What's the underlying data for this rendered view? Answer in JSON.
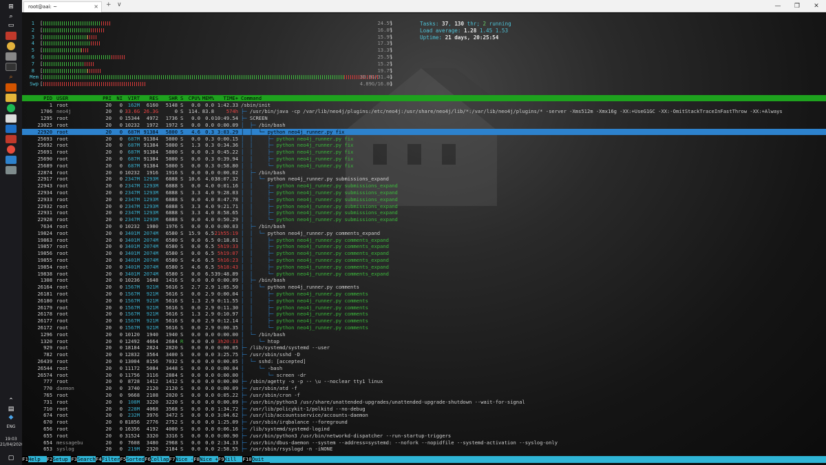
{
  "window": {
    "tab_title": "root@aai: ~",
    "new_tab": "+",
    "dropdown": "∨",
    "minimize": "—",
    "maximize": "❐",
    "close": "✕",
    "tab_close": "×"
  },
  "taskbar": {
    "lang": "ENG",
    "time": "19:03",
    "date": "21/04/2020"
  },
  "meters": {
    "cpus": [
      {
        "id": "1",
        "pct": "24.5%",
        "green": 0.17,
        "red": 0.03
      },
      {
        "id": "2",
        "pct": "16.0%",
        "green": 0.14,
        "red": 0.04
      },
      {
        "id": "3",
        "pct": "15.9%",
        "green": 0.13,
        "red": 0.03
      },
      {
        "id": "4",
        "pct": "17.3%",
        "green": 0.14,
        "red": 0.03
      },
      {
        "id": "5",
        "pct": "13.3%",
        "green": 0.11,
        "red": 0.02
      },
      {
        "id": "6",
        "pct": "25.5%",
        "green": 0.2,
        "red": 0.04
      },
      {
        "id": "7",
        "pct": "15.2%",
        "green": 0.12,
        "red": 0.03
      },
      {
        "id": "8",
        "pct": "19.7%",
        "green": 0.13,
        "red": 0.04
      }
    ],
    "mem": {
      "label": "Mem",
      "text": "30.8G/31.4G",
      "fill": 0.98
    },
    "swp": {
      "label": "Swp",
      "text": "4.89G/16.0G",
      "fill": 0.3
    }
  },
  "info": {
    "tasks_label": "Tasks: ",
    "tasks": "37",
    "thr_sep": ", ",
    "thr": "130",
    "thr_label": " thr; ",
    "running": "2",
    "running_label": " running",
    "load_label": "Load average: ",
    "load1": "1.28",
    "load5": "1.45",
    "load15": "1.53",
    "uptime_label": "Uptime: ",
    "uptime": "21 days, 20:25:54"
  },
  "columns": [
    "PID",
    "USER",
    "PRI",
    "NI",
    "VIRT",
    "RES",
    "SHR",
    "S",
    "CPU%",
    "MEM%",
    "TIME+",
    "Command"
  ],
  "processes": [
    {
      "pid": "1",
      "user": "root",
      "pri": "20",
      "ni": "0",
      "virt": "162M",
      "res": "6160",
      "shr": "5148",
      "s": "S",
      "cpu": "0.0",
      "mem": "0.0",
      "time": "1:42.33",
      "tree": "",
      "cmd": "/sbin/init"
    },
    {
      "pid": "1706",
      "user": "neo4j",
      "pri": "20",
      "ni": "0",
      "virt": "33.6G",
      "res": "26.3G",
      "shr": "0",
      "s": "S",
      "cpu": "114.",
      "mem": "83.8",
      "time": "574h",
      "tree": "├─ ",
      "cmd": "/usr/bin/java -cp /var/lib/neo4j/plugins:/etc/neo4j:/usr/share/neo4j/lib/*:/var/lib/neo4j/plugins/* -server -Xms512m -Xmx16g -XX:+UseG1GC -XX:-OmitStackTraceInFastThrow -XX:+Always"
    },
    {
      "pid": "1295",
      "user": "root",
      "pri": "20",
      "ni": "0",
      "virt": "15344",
      "res": "4972",
      "shr": "1736",
      "s": "S",
      "cpu": "0.0",
      "mem": "0.0",
      "time": "10:49.54",
      "tree": "├─ ",
      "cmd": "SCREEN"
    },
    {
      "pid": "23025",
      "user": "root",
      "pri": "20",
      "ni": "0",
      "virt": "10232",
      "res": "1972",
      "shr": "1972",
      "s": "S",
      "cpu": "0.0",
      "mem": "0.0",
      "time": "0:00.09",
      "tree": "│  ├─ ",
      "cmd": "/bin/bash"
    },
    {
      "pid": "22920",
      "user": "root",
      "pri": "20",
      "ni": "0",
      "virt": "687M",
      "res": "91384",
      "shr": "5800",
      "s": "S",
      "cpu": "4.6",
      "mem": "0.3",
      "time": "3:03.29",
      "tree": "│  │  └─ ",
      "cmd": "python neo4j_runner.py fix",
      "sel": true
    },
    {
      "pid": "25693",
      "user": "root",
      "pri": "20",
      "ni": "0",
      "virt": "687M",
      "res": "91384",
      "shr": "5800",
      "s": "S",
      "cpu": "0.0",
      "mem": "0.3",
      "time": "0:00.15",
      "tree": "│  │     ├─ ",
      "cmd": "python neo4j_runner.py fix",
      "thread": true
    },
    {
      "pid": "25692",
      "user": "root",
      "pri": "20",
      "ni": "0",
      "virt": "687M",
      "res": "91384",
      "shr": "5800",
      "s": "S",
      "cpu": "1.3",
      "mem": "0.3",
      "time": "0:34.36",
      "tree": "│  │     ├─ ",
      "cmd": "python neo4j_runner.py fix",
      "thread": true
    },
    {
      "pid": "25691",
      "user": "root",
      "pri": "20",
      "ni": "0",
      "virt": "687M",
      "res": "91384",
      "shr": "5800",
      "s": "S",
      "cpu": "0.0",
      "mem": "0.3",
      "time": "0:45.22",
      "tree": "│  │     ├─ ",
      "cmd": "python neo4j_runner.py fix",
      "thread": true
    },
    {
      "pid": "25690",
      "user": "root",
      "pri": "20",
      "ni": "0",
      "virt": "687M",
      "res": "91384",
      "shr": "5800",
      "s": "S",
      "cpu": "0.0",
      "mem": "0.3",
      "time": "0:39.94",
      "tree": "│  │     ├─ ",
      "cmd": "python neo4j_runner.py fix",
      "thread": true
    },
    {
      "pid": "25689",
      "user": "root",
      "pri": "20",
      "ni": "0",
      "virt": "687M",
      "res": "91384",
      "shr": "5800",
      "s": "S",
      "cpu": "0.0",
      "mem": "0.3",
      "time": "0:58.80",
      "tree": "│  │     └─ ",
      "cmd": "python neo4j_runner.py fix",
      "thread": true
    },
    {
      "pid": "22874",
      "user": "root",
      "pri": "20",
      "ni": "0",
      "virt": "10232",
      "res": "1916",
      "shr": "1916",
      "s": "S",
      "cpu": "0.0",
      "mem": "0.0",
      "time": "0:00.02",
      "tree": "│  ├─ ",
      "cmd": "/bin/bash"
    },
    {
      "pid": "22917",
      "user": "root",
      "pri": "20",
      "ni": "0",
      "virt": "2347M",
      "res": "1293M",
      "shr": "6888",
      "s": "S",
      "cpu": "10.6",
      "mem": "4.0",
      "time": "38:07.32",
      "tree": "│  │  └─ ",
      "cmd": "python neo4j_runner.py submissions_expand"
    },
    {
      "pid": "22943",
      "user": "root",
      "pri": "20",
      "ni": "0",
      "virt": "2347M",
      "res": "1293M",
      "shr": "6888",
      "s": "S",
      "cpu": "0.0",
      "mem": "4.0",
      "time": "0:01.16",
      "tree": "│  │     ├─ ",
      "cmd": "python neo4j_runner.py submissions_expand",
      "thread": true
    },
    {
      "pid": "22934",
      "user": "root",
      "pri": "20",
      "ni": "0",
      "virt": "2347M",
      "res": "1293M",
      "shr": "6888",
      "s": "S",
      "cpu": "3.3",
      "mem": "4.0",
      "time": "9:28.03",
      "tree": "│  │     ├─ ",
      "cmd": "python neo4j_runner.py submissions_expand",
      "thread": true
    },
    {
      "pid": "22933",
      "user": "root",
      "pri": "20",
      "ni": "0",
      "virt": "2347M",
      "res": "1293M",
      "shr": "6888",
      "s": "S",
      "cpu": "0.0",
      "mem": "4.0",
      "time": "8:47.78",
      "tree": "│  │     ├─ ",
      "cmd": "python neo4j_runner.py submissions_expand",
      "thread": true
    },
    {
      "pid": "22932",
      "user": "root",
      "pri": "20",
      "ni": "0",
      "virt": "2347M",
      "res": "1293M",
      "shr": "6888",
      "s": "S",
      "cpu": "3.3",
      "mem": "4.0",
      "time": "9:21.71",
      "tree": "│  │     ├─ ",
      "cmd": "python neo4j_runner.py submissions_expand",
      "thread": true
    },
    {
      "pid": "22931",
      "user": "root",
      "pri": "20",
      "ni": "0",
      "virt": "2347M",
      "res": "1293M",
      "shr": "6888",
      "s": "S",
      "cpu": "3.3",
      "mem": "4.0",
      "time": "8:58.65",
      "tree": "│  │     ├─ ",
      "cmd": "python neo4j_runner.py submissions_expand",
      "thread": true
    },
    {
      "pid": "22928",
      "user": "root",
      "pri": "20",
      "ni": "0",
      "virt": "2347M",
      "res": "1293M",
      "shr": "6888",
      "s": "S",
      "cpu": "0.0",
      "mem": "4.0",
      "time": "0:50.29",
      "tree": "│  │     └─ ",
      "cmd": "python neo4j_runner.py submissions_expand",
      "thread": true
    },
    {
      "pid": "7634",
      "user": "root",
      "pri": "20",
      "ni": "0",
      "virt": "10232",
      "res": "1980",
      "shr": "1976",
      "s": "S",
      "cpu": "0.0",
      "mem": "0.0",
      "time": "0:00.03",
      "tree": "│  ├─ ",
      "cmd": "/bin/bash"
    },
    {
      "pid": "19824",
      "user": "root",
      "pri": "20",
      "ni": "0",
      "virt": "3401M",
      "res": "2074M",
      "shr": "6580",
      "s": "S",
      "cpu": "15.9",
      "mem": "6.5",
      "time": "21h55:19",
      "tree": "│  │  └─ ",
      "cmd": "python neo4j_runner.py comments_expand"
    },
    {
      "pid": "19863",
      "user": "root",
      "pri": "20",
      "ni": "0",
      "virt": "3401M",
      "res": "2074M",
      "shr": "6580",
      "s": "S",
      "cpu": "0.0",
      "mem": "6.5",
      "time": "0:18.61",
      "tree": "│  │     ├─ ",
      "cmd": "python neo4j_runner.py comments_expand",
      "thread": true
    },
    {
      "pid": "19857",
      "user": "root",
      "pri": "20",
      "ni": "0",
      "virt": "3401M",
      "res": "2074M",
      "shr": "6580",
      "s": "S",
      "cpu": "0.0",
      "mem": "6.5",
      "time": "5h19:33",
      "tree": "│  │     ├─ ",
      "cmd": "python neo4j_runner.py comments_expand",
      "thread": true
    },
    {
      "pid": "19856",
      "user": "root",
      "pri": "20",
      "ni": "0",
      "virt": "3401M",
      "res": "2074M",
      "shr": "6580",
      "s": "S",
      "cpu": "0.0",
      "mem": "6.5",
      "time": "5h19:07",
      "tree": "│  │     ├─ ",
      "cmd": "python neo4j_runner.py comments_expand",
      "thread": true
    },
    {
      "pid": "19855",
      "user": "root",
      "pri": "20",
      "ni": "0",
      "virt": "3401M",
      "res": "2074M",
      "shr": "6580",
      "s": "S",
      "cpu": "4.6",
      "mem": "6.5",
      "time": "5h16:23",
      "tree": "│  │     ├─ ",
      "cmd": "python neo4j_runner.py comments_expand",
      "thread": true
    },
    {
      "pid": "19854",
      "user": "root",
      "pri": "20",
      "ni": "0",
      "virt": "3401M",
      "res": "2074M",
      "shr": "6580",
      "s": "S",
      "cpu": "4.6",
      "mem": "6.5",
      "time": "5h18:43",
      "tree": "│  │     ├─ ",
      "cmd": "python neo4j_runner.py comments_expand",
      "thread": true
    },
    {
      "pid": "19838",
      "user": "root",
      "pri": "20",
      "ni": "0",
      "virt": "3401M",
      "res": "2074M",
      "shr": "6580",
      "s": "S",
      "cpu": "0.0",
      "mem": "6.5",
      "time": "39:48.89",
      "tree": "│  │     └─ ",
      "cmd": "python neo4j_runner.py comments_expand",
      "thread": true
    },
    {
      "pid": "1308",
      "user": "root",
      "pri": "20",
      "ni": "0",
      "virt": "10236",
      "res": "1648",
      "shr": "1416",
      "s": "S",
      "cpu": "0.0",
      "mem": "0.0",
      "time": "0:00.09",
      "tree": "│  ├─ ",
      "cmd": "/bin/bash"
    },
    {
      "pid": "26164",
      "user": "root",
      "pri": "20",
      "ni": "0",
      "virt": "1567M",
      "res": "921M",
      "shr": "5616",
      "s": "S",
      "cpu": "2.7",
      "mem": "2.9",
      "time": "1:05.50",
      "tree": "│  │  └─ ",
      "cmd": "python neo4j_runner.py comments"
    },
    {
      "pid": "26181",
      "user": "root",
      "pri": "20",
      "ni": "0",
      "virt": "1567M",
      "res": "921M",
      "shr": "5616",
      "s": "S",
      "cpu": "0.0",
      "mem": "2.9",
      "time": "0:00.04",
      "tree": "│  │     ├─ ",
      "cmd": "python neo4j_runner.py comments",
      "thread": true
    },
    {
      "pid": "26180",
      "user": "root",
      "pri": "20",
      "ni": "0",
      "virt": "1567M",
      "res": "921M",
      "shr": "5616",
      "s": "S",
      "cpu": "1.3",
      "mem": "2.9",
      "time": "0:11.55",
      "tree": "│  │     ├─ ",
      "cmd": "python neo4j_runner.py comments",
      "thread": true
    },
    {
      "pid": "26179",
      "user": "root",
      "pri": "20",
      "ni": "0",
      "virt": "1567M",
      "res": "921M",
      "shr": "5616",
      "s": "S",
      "cpu": "0.0",
      "mem": "2.9",
      "time": "0:11.30",
      "tree": "│  │     ├─ ",
      "cmd": "python neo4j_runner.py comments",
      "thread": true
    },
    {
      "pid": "26178",
      "user": "root",
      "pri": "20",
      "ni": "0",
      "virt": "1567M",
      "res": "921M",
      "shr": "5616",
      "s": "S",
      "cpu": "1.3",
      "mem": "2.9",
      "time": "0:10.97",
      "tree": "│  │     ├─ ",
      "cmd": "python neo4j_runner.py comments",
      "thread": true
    },
    {
      "pid": "26177",
      "user": "root",
      "pri": "20",
      "ni": "0",
      "virt": "1567M",
      "res": "921M",
      "shr": "5616",
      "s": "S",
      "cpu": "0.0",
      "mem": "2.9",
      "time": "0:12.14",
      "tree": "│  │     ├─ ",
      "cmd": "python neo4j_runner.py comments",
      "thread": true
    },
    {
      "pid": "26172",
      "user": "root",
      "pri": "20",
      "ni": "0",
      "virt": "1567M",
      "res": "921M",
      "shr": "5616",
      "s": "S",
      "cpu": "0.0",
      "mem": "2.9",
      "time": "0:00.35",
      "tree": "│  │     └─ ",
      "cmd": "python neo4j_runner.py comments",
      "thread": true
    },
    {
      "pid": "1296",
      "user": "root",
      "pri": "20",
      "ni": "0",
      "virt": "10120",
      "res": "1940",
      "shr": "1940",
      "s": "S",
      "cpu": "0.0",
      "mem": "0.0",
      "time": "0:00.00",
      "tree": "│  └─ ",
      "cmd": "/bin/bash"
    },
    {
      "pid": "1320",
      "user": "root",
      "pri": "20",
      "ni": "0",
      "virt": "12492",
      "res": "4664",
      "shr": "2684",
      "s": "R",
      "cpu": "0.0",
      "mem": "0.0",
      "time": "3h20:33",
      "tree": "│     └─ ",
      "cmd": "htop"
    },
    {
      "pid": "929",
      "user": "root",
      "pri": "20",
      "ni": "0",
      "virt": "18184",
      "res": "2824",
      "shr": "2820",
      "s": "S",
      "cpu": "0.0",
      "mem": "0.0",
      "time": "0:00.05",
      "tree": "├─ ",
      "cmd": "/lib/systemd/systemd --user"
    },
    {
      "pid": "782",
      "user": "root",
      "pri": "20",
      "ni": "0",
      "virt": "12832",
      "res": "3564",
      "shr": "3400",
      "s": "S",
      "cpu": "0.0",
      "mem": "0.0",
      "time": "3:25.75",
      "tree": "├─ ",
      "cmd": "/usr/sbin/sshd -D"
    },
    {
      "pid": "26439",
      "user": "root",
      "pri": "20",
      "ni": "0",
      "virt": "13004",
      "res": "8156",
      "shr": "7032",
      "s": "S",
      "cpu": "0.0",
      "mem": "0.0",
      "time": "0:00.05",
      "tree": "│  └─ ",
      "cmd": "sshd: [accepted]"
    },
    {
      "pid": "26544",
      "user": "root",
      "pri": "20",
      "ni": "0",
      "virt": "11172",
      "res": "5084",
      "shr": "3448",
      "s": "S",
      "cpu": "0.0",
      "mem": "0.0",
      "time": "0:00.04",
      "tree": "│     └─ ",
      "cmd": "-bash"
    },
    {
      "pid": "26574",
      "user": "root",
      "pri": "20",
      "ni": "0",
      "virt": "11756",
      "res": "3116",
      "shr": "2884",
      "s": "S",
      "cpu": "0.0",
      "mem": "0.0",
      "time": "0:00.00",
      "tree": "│        └─ ",
      "cmd": "screen -dr"
    },
    {
      "pid": "777",
      "user": "root",
      "pri": "20",
      "ni": "0",
      "virt": "8728",
      "res": "1412",
      "shr": "1412",
      "s": "S",
      "cpu": "0.0",
      "mem": "0.0",
      "time": "0:00.00",
      "tree": "├─ ",
      "cmd": "/sbin/agetty -o -p -- \\u --noclear tty1 linux"
    },
    {
      "pid": "770",
      "user": "daemon",
      "pri": "20",
      "ni": "0",
      "virt": "3740",
      "res": "2120",
      "shr": "2120",
      "s": "S",
      "cpu": "0.0",
      "mem": "0.0",
      "time": "0:00.09",
      "tree": "├─ ",
      "cmd": "/usr/sbin/atd -f"
    },
    {
      "pid": "765",
      "user": "root",
      "pri": "20",
      "ni": "0",
      "virt": "9668",
      "res": "2108",
      "shr": "2020",
      "s": "S",
      "cpu": "0.0",
      "mem": "0.0",
      "time": "0:05.22",
      "tree": "├─ ",
      "cmd": "/usr/sbin/cron -f"
    },
    {
      "pid": "731",
      "user": "root",
      "pri": "20",
      "ni": "0",
      "virt": "108M",
      "res": "3220",
      "shr": "3220",
      "s": "S",
      "cpu": "0.0",
      "mem": "0.0",
      "time": "0:00.09",
      "tree": "├─ ",
      "cmd": "/usr/bin/python3 /usr/share/unattended-upgrades/unattended-upgrade-shutdown --wait-for-signal"
    },
    {
      "pid": "710",
      "user": "root",
      "pri": "20",
      "ni": "0",
      "virt": "228M",
      "res": "4068",
      "shr": "3568",
      "s": "S",
      "cpu": "0.0",
      "mem": "0.0",
      "time": "1:34.72",
      "tree": "├─ ",
      "cmd": "/usr/lib/policykit-1/polkitd --no-debug"
    },
    {
      "pid": "674",
      "user": "root",
      "pri": "20",
      "ni": "0",
      "virt": "232M",
      "res": "3976",
      "shr": "3472",
      "s": "S",
      "cpu": "0.0",
      "mem": "0.0",
      "time": "3:04.62",
      "tree": "├─ ",
      "cmd": "/usr/lib/accountsservice/accounts-daemon"
    },
    {
      "pid": "670",
      "user": "root",
      "pri": "20",
      "ni": "0",
      "virt": "81856",
      "res": "2776",
      "shr": "2752",
      "s": "S",
      "cpu": "0.0",
      "mem": "0.0",
      "time": "1:25.09",
      "tree": "├─ ",
      "cmd": "/usr/sbin/irqbalance --foreground"
    },
    {
      "pid": "656",
      "user": "root",
      "pri": "20",
      "ni": "0",
      "virt": "16356",
      "res": "4192",
      "shr": "4000",
      "s": "S",
      "cpu": "0.0",
      "mem": "0.0",
      "time": "0:06.16",
      "tree": "├─ ",
      "cmd": "/lib/systemd/systemd-logind"
    },
    {
      "pid": "655",
      "user": "root",
      "pri": "20",
      "ni": "0",
      "virt": "31524",
      "res": "3320",
      "shr": "3316",
      "s": "S",
      "cpu": "0.0",
      "mem": "0.0",
      "time": "0:00.90",
      "tree": "├─ ",
      "cmd": "/usr/bin/python3 /usr/bin/networkd-dispatcher --run-startup-triggers"
    },
    {
      "pid": "654",
      "user": "messagebu",
      "pri": "20",
      "ni": "0",
      "virt": "7608",
      "res": "3480",
      "shr": "2968",
      "s": "S",
      "cpu": "0.0",
      "mem": "0.0",
      "time": "2:34.33",
      "tree": "├─ ",
      "cmd": "/usr/bin/dbus-daemon --system --address=systemd: --nofork --nopidfile --systemd-activation --syslog-only"
    },
    {
      "pid": "653",
      "user": "syslog",
      "pri": "20",
      "ni": "0",
      "virt": "219M",
      "res": "2320",
      "shr": "2184",
      "s": "S",
      "cpu": "0.0",
      "mem": "0.0",
      "time": "2:58.55",
      "tree": "├─ ",
      "cmd": "/usr/sbin/rsyslogd -n -iNONE"
    }
  ],
  "fkeys": [
    {
      "k": "F1",
      "l": "Help  "
    },
    {
      "k": "F2",
      "l": "Setup "
    },
    {
      "k": "F3",
      "l": "Search"
    },
    {
      "k": "F4",
      "l": "Filter"
    },
    {
      "k": "F5",
      "l": "Sorted"
    },
    {
      "k": "F6",
      "l": "Collap"
    },
    {
      "k": "F7",
      "l": "Nice -"
    },
    {
      "k": "F8",
      "l": "Nice +"
    },
    {
      "k": "F9",
      "l": "Kill  "
    },
    {
      "k": "F10",
      "l": "Quit  "
    }
  ],
  "colors": {
    "header_bg": "#1ea21e",
    "selected_bg": "#2d82cd",
    "thread_fg": "#3dbb3d",
    "tree_fg": "#2d82cd",
    "meter_green": "#3dbb3d",
    "meter_red": "#d83a3a",
    "fkey_bg": "#2fb5d6"
  }
}
